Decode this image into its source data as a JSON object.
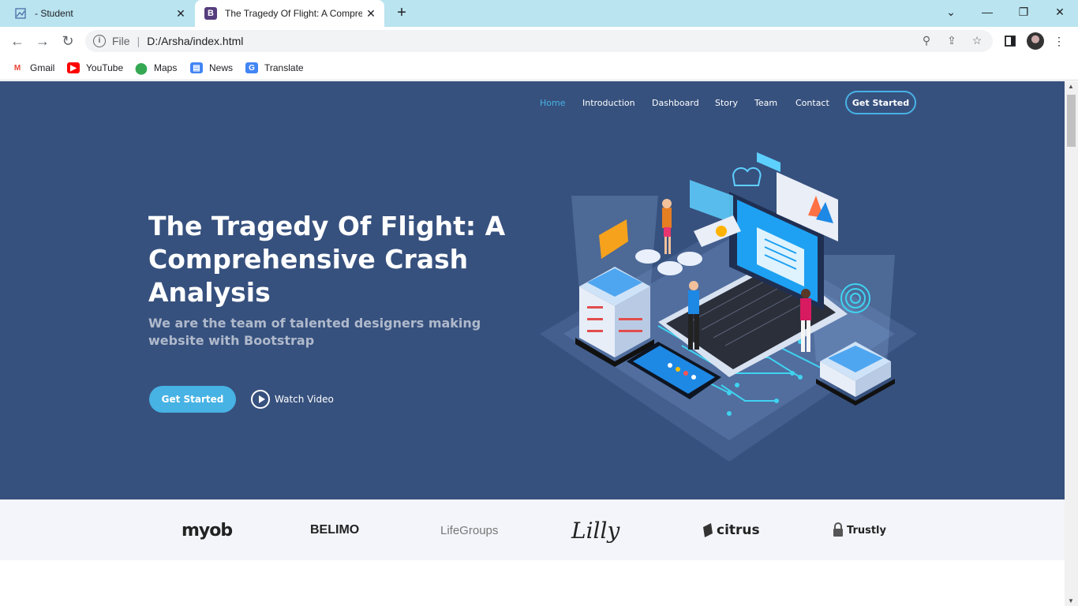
{
  "browser": {
    "tabs": [
      {
        "title": "- Student",
        "active": false
      },
      {
        "title": "The Tragedy Of Flight: A Compre",
        "active": true
      }
    ],
    "favicon_active": "B",
    "address": {
      "scheme": "File",
      "url": "D:/Arsha/index.html"
    },
    "bookmarks": [
      {
        "label": "Gmail",
        "icon": "gmail-icon"
      },
      {
        "label": "YouTube",
        "icon": "youtube-icon"
      },
      {
        "label": "Maps",
        "icon": "maps-icon"
      },
      {
        "label": "News",
        "icon": "news-icon"
      },
      {
        "label": "Translate",
        "icon": "translate-icon"
      }
    ]
  },
  "page": {
    "nav": {
      "items": [
        "Home",
        "Introduction",
        "Dashboard",
        "Story",
        "Team",
        "Contact"
      ],
      "active": "Home",
      "cta": "Get Started"
    },
    "hero": {
      "title": "The Tragedy Of Flight: A Comprehensive Crash Analysis",
      "subtitle": "We are the team of talented designers making website with Bootstrap",
      "primary_button": "Get Started",
      "video_button": "Watch Video"
    },
    "clients": [
      "myob",
      "BELIMO",
      "LifeGroups",
      "Lilly",
      "citrus",
      "Trustly"
    ]
  },
  "colors": {
    "hero_bg": "#37517e",
    "accent": "#47b2e4",
    "clients_bg": "#f3f5fa",
    "tabbar_bg": "#b9e4f0"
  }
}
